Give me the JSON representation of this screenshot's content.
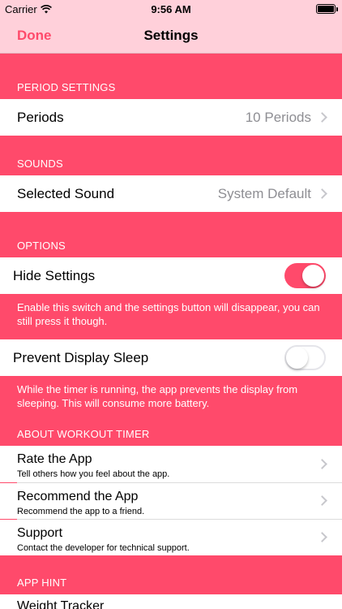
{
  "status": {
    "carrier": "Carrier",
    "time": "9:56 AM"
  },
  "nav": {
    "done": "Done",
    "title": "Settings"
  },
  "period_settings": {
    "header": "PERIOD SETTINGS",
    "label": "Periods",
    "value": "10 Periods"
  },
  "sounds": {
    "header": "SOUNDS",
    "label": "Selected Sound",
    "value": "System Default"
  },
  "options": {
    "header": "OPTIONS",
    "hide_settings": {
      "label": "Hide Settings",
      "on": true,
      "footer": "Enable this switch and the settings button will disappear, you can still press it though."
    },
    "prevent_sleep": {
      "label": "Prevent Display Sleep",
      "on": false,
      "footer": "While the timer is running, the app prevents the display from sleeping. This will consume more battery."
    }
  },
  "about": {
    "header": "ABOUT WORKOUT TIMER",
    "items": [
      {
        "title": "Rate the App",
        "subtitle": "Tell others how you feel about the app."
      },
      {
        "title": "Recommend the App",
        "subtitle": "Recommend the app to a friend."
      },
      {
        "title": "Support",
        "subtitle": "Contact the developer for technical support."
      }
    ]
  },
  "app_hint": {
    "header": "APP HINT",
    "first_item": "Weight Tracker"
  },
  "colors": {
    "accent": "#FF4A6B",
    "bar": "#FFD0DA"
  }
}
